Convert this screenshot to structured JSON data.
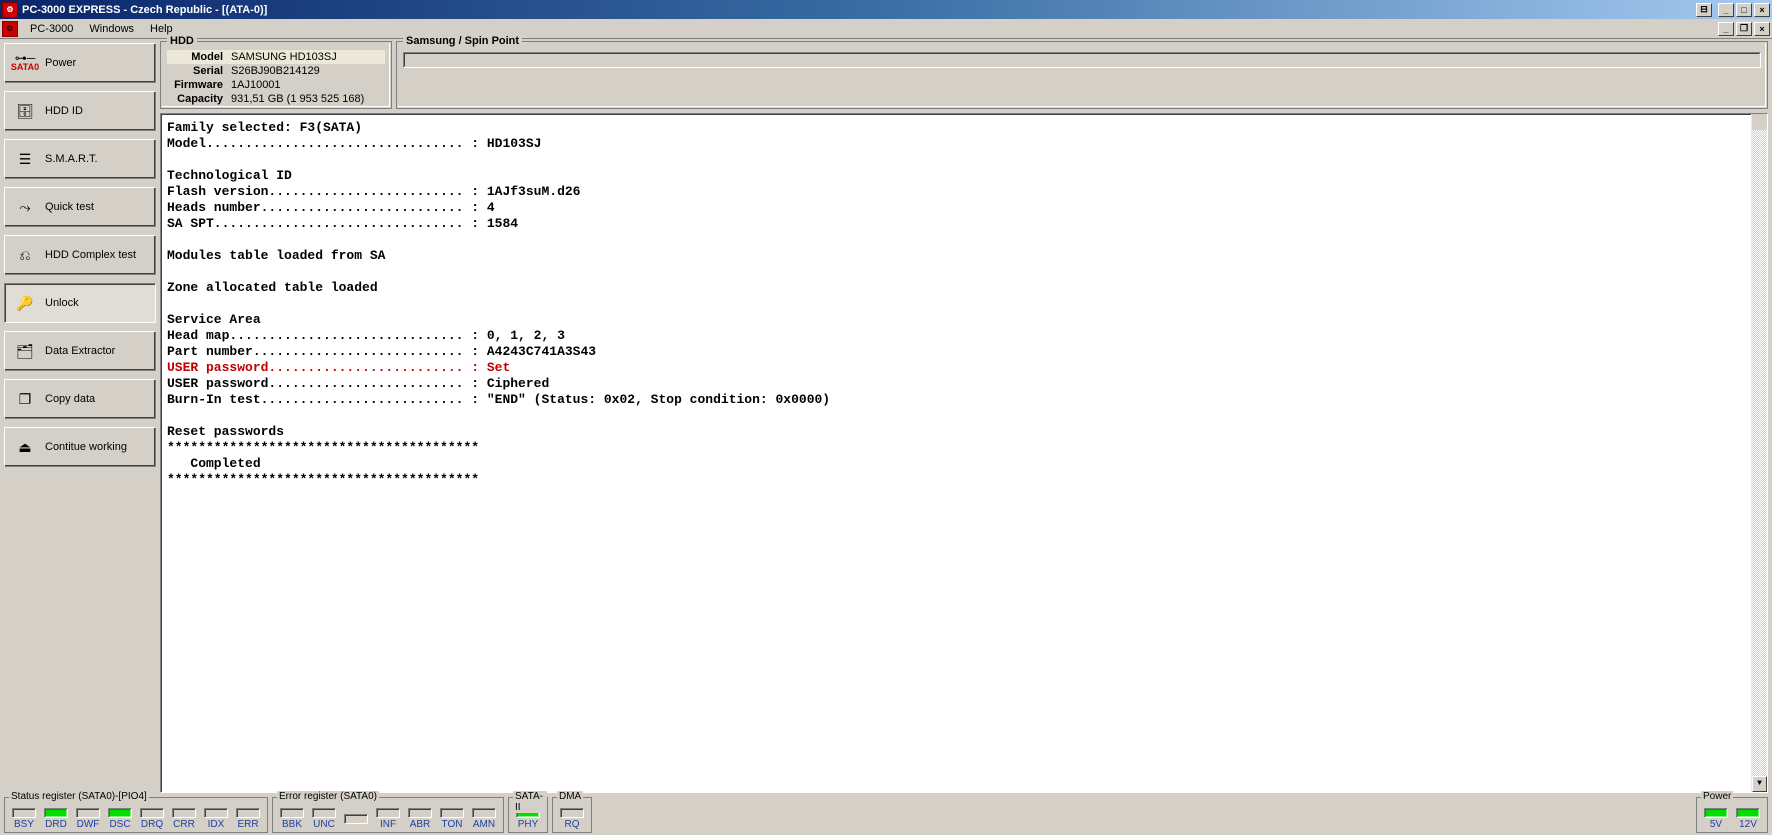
{
  "title": "PC-3000 EXPRESS - Czech Republic - [(ATA-0)]",
  "menu": {
    "pc3000": "PC-3000",
    "windows": "Windows",
    "help": "Help"
  },
  "sidebar": {
    "power": "Power",
    "sata": "SATA0",
    "hddid": "HDD ID",
    "smart": "S.M.A.R.T.",
    "quick": "Quick test",
    "complex": "HDD Complex test",
    "unlock": "Unlock",
    "extractor": "Data Extractor",
    "copy": "Copy data",
    "cont": "Contitue working"
  },
  "hdd": {
    "legend": "HDD",
    "model_k": "Model",
    "model_v": "SAMSUNG HD103SJ",
    "serial_k": "Serial",
    "serial_v": "S26BJ90B214129",
    "fw_k": "Firmware",
    "fw_v": "1AJ10001",
    "cap_k": "Capacity",
    "cap_v": "931,51 GB (1 953 525 168)"
  },
  "spinbox": {
    "legend": "Samsung / Spin Point"
  },
  "console": {
    "l1": "Family selected: F3(SATA)",
    "l2": "Model................................. : HD103SJ",
    "l3": "",
    "l4": "Technological ID",
    "l5": "Flash version......................... : 1AJf3suM.d26",
    "l6": "Heads number.......................... : 4",
    "l7": "SA SPT................................ : 1584",
    "l8": "",
    "l9": "Modules table loaded from SA",
    "l10": "",
    "l11": "Zone allocated table loaded",
    "l12": "",
    "l13": "Service Area",
    "l14": "Head map.............................. : 0, 1, 2, 3",
    "l15": "Part number........................... : A4243C741A3S43",
    "l16": "USER password......................... : Set",
    "l17": "USER password......................... : Ciphered",
    "l18": "Burn-In test.......................... : \"END\" (Status: 0x02, Stop condition: 0x0000)",
    "l19": "",
    "l20": "Reset passwords",
    "l21": "****************************************",
    "l22": "   Completed",
    "l23": "****************************************"
  },
  "status": {
    "reg": "Status register (SATA0)-[PIO4]",
    "err": "Error register (SATA0)",
    "sata2": "SATA-II",
    "dma": "DMA",
    "power": "Power",
    "leds1": [
      "BSY",
      "DRD",
      "DWF",
      "DSC",
      "DRQ",
      "CRR",
      "IDX",
      "ERR"
    ],
    "leds2": [
      "BBK",
      "UNC",
      "",
      "INF",
      "ABR",
      "TON",
      "AMN"
    ],
    "leds3": [
      "PHY"
    ],
    "leds4": [
      "RQ"
    ],
    "leds5": [
      "5V",
      "12V"
    ]
  }
}
